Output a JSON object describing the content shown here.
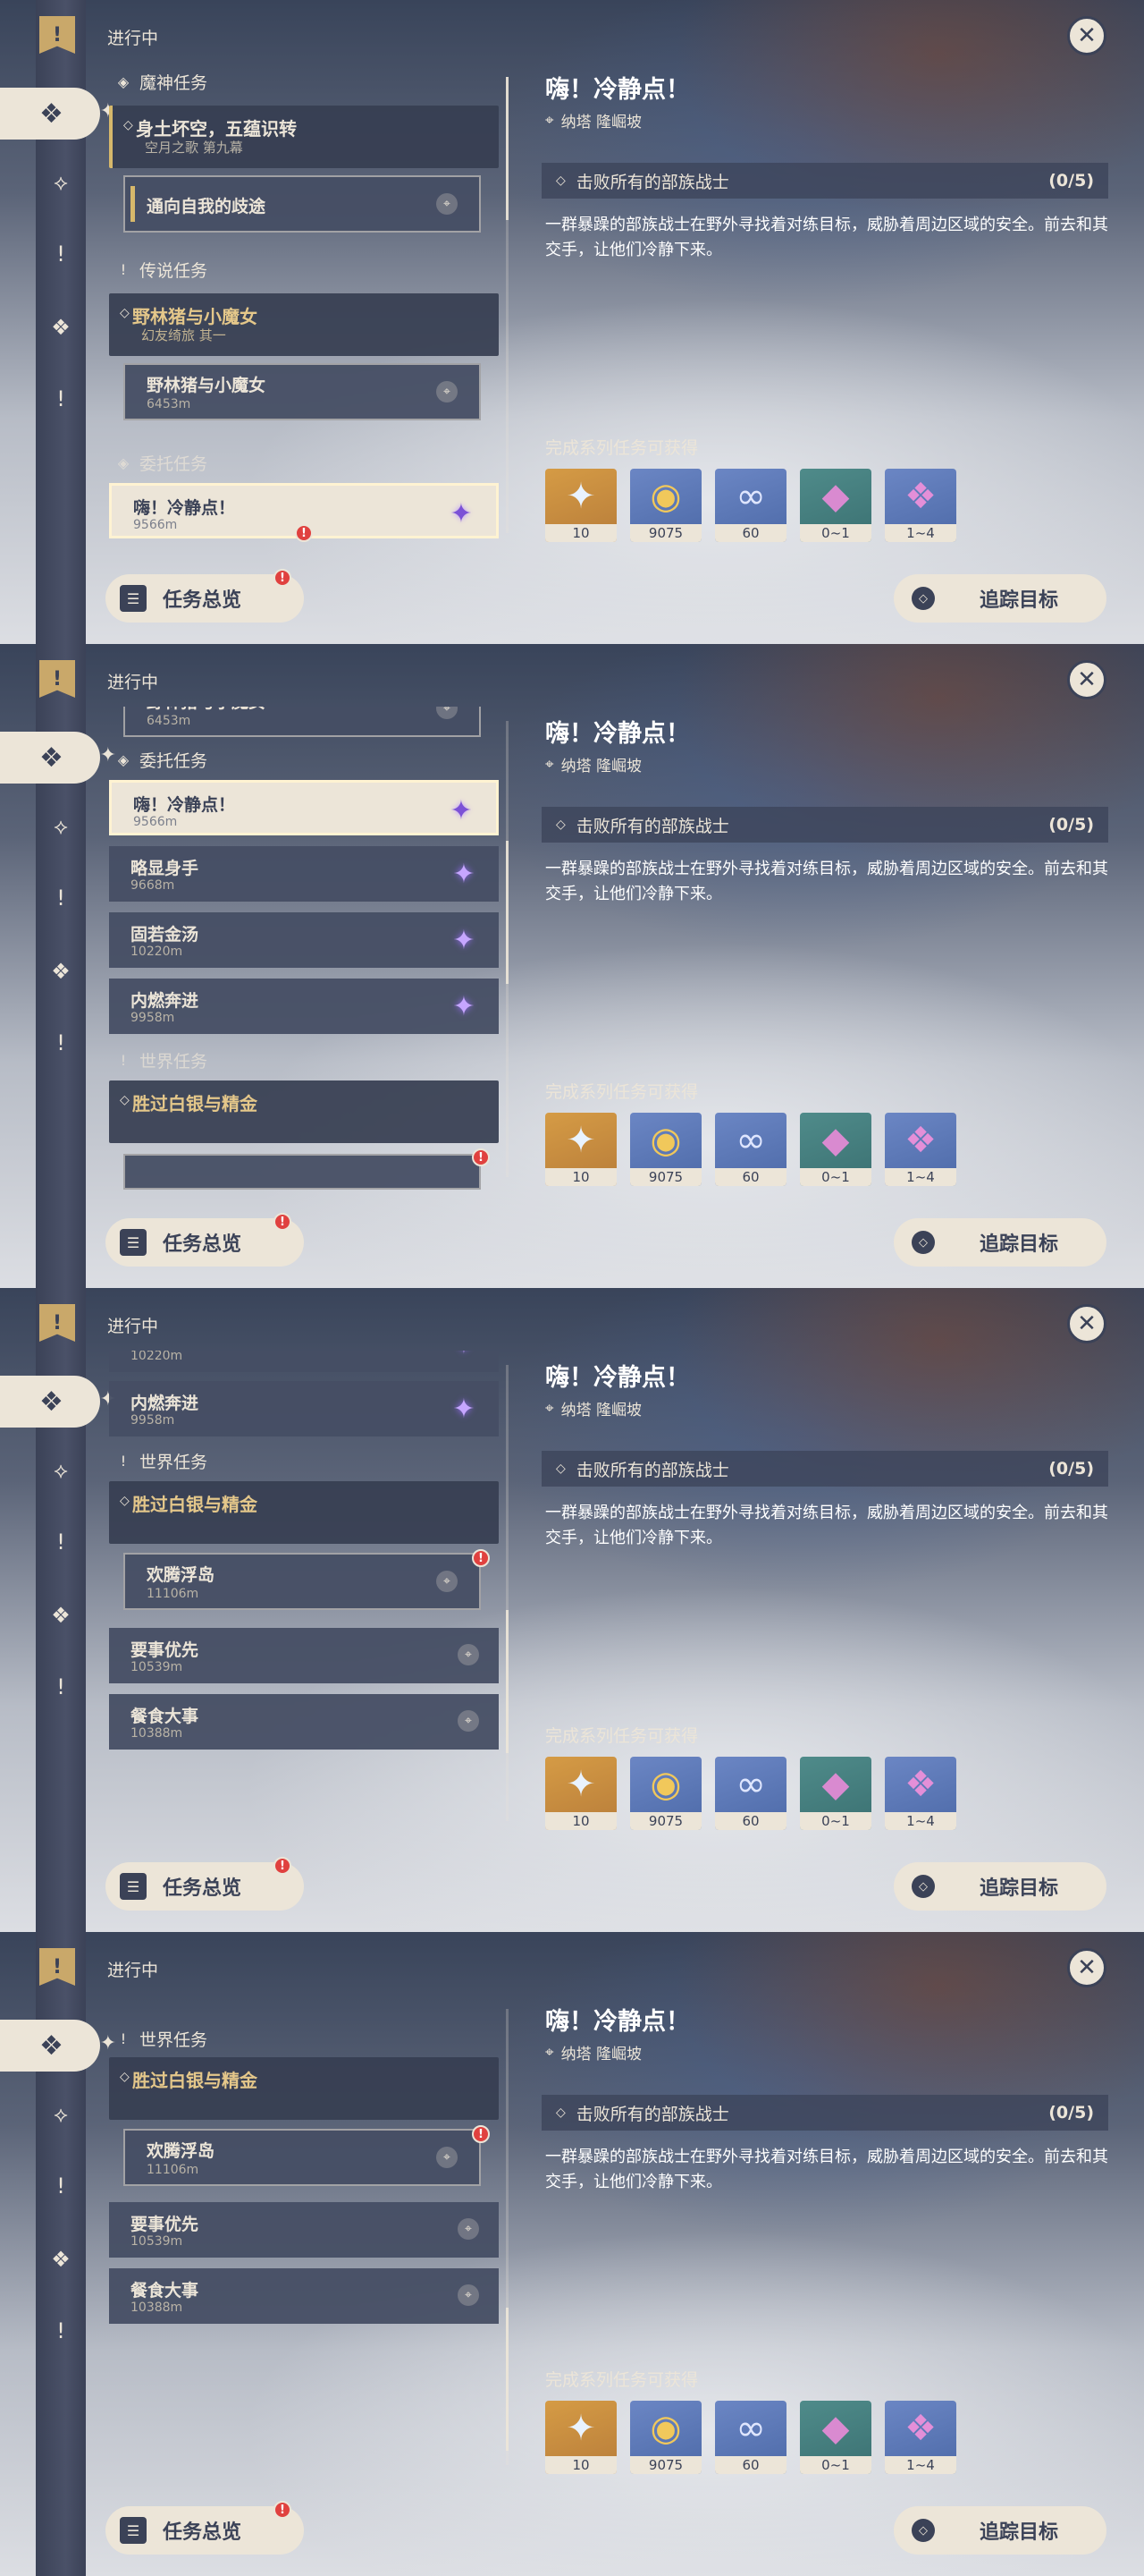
{
  "header": {
    "in_progress": "进行中",
    "close_glyph": "✕"
  },
  "rail": {
    "bookmark": "!",
    "items": [
      "⟡",
      "!",
      "❖",
      "!"
    ]
  },
  "detail": {
    "title": "嗨！冷静点！",
    "location": "纳塔 隆崛坡",
    "objective": "击败所有的部族战士",
    "progress": "(0/5)",
    "description": "一群暴躁的部族战士在野外寻找着对练目标，威胁着周边区域的安全。前去和其交手，让他们冷静下来。",
    "reward_title": "完成系列任务可获得",
    "rewards": [
      {
        "count": "10",
        "icon": "primogem-icon",
        "glyph": "✦"
      },
      {
        "count": "9075",
        "icon": "mora-icon",
        "glyph": "◉"
      },
      {
        "count": "60",
        "icon": "adventure-exp-icon",
        "glyph": "∞"
      },
      {
        "count": "0~1",
        "icon": "crystal-icon",
        "glyph": "◆"
      },
      {
        "count": "1~4",
        "icon": "crystal-cluster-icon",
        "glyph": "❖"
      }
    ]
  },
  "buttons": {
    "overview": "任务总览",
    "track": "追踪目标",
    "alert": "!"
  },
  "sections": {
    "archon": "魔神任务",
    "legend": "传说任务",
    "commission": "委托任务",
    "world": "世界任务"
  },
  "quests": {
    "archon_main": {
      "name": "身土坏空，五蕴识转",
      "sub": "空月之歌 第九幕"
    },
    "archon_step": {
      "name": "通向自我的歧途"
    },
    "legend_main": {
      "name": "野林猪与小魔女",
      "sub": "幻友绮旅 其一"
    },
    "legend_step": {
      "name": "野林猪与小魔女",
      "dist": "6453m"
    },
    "c1": {
      "name": "嗨！冷静点！",
      "dist": "9566m"
    },
    "c2": {
      "name": "略显身手",
      "dist": "9668m"
    },
    "c3": {
      "name": "固若金汤",
      "dist": "10220m"
    },
    "c4": {
      "name": "内燃奔进",
      "dist": "9958m"
    },
    "world_main": {
      "name": "胜过白银与精金"
    },
    "world_step": {
      "name": "欢腾浮岛",
      "dist": "11106m"
    },
    "w2": {
      "name": "要事优先",
      "dist": "10539m"
    },
    "w3": {
      "name": "餐食大事",
      "dist": "10388m"
    }
  }
}
